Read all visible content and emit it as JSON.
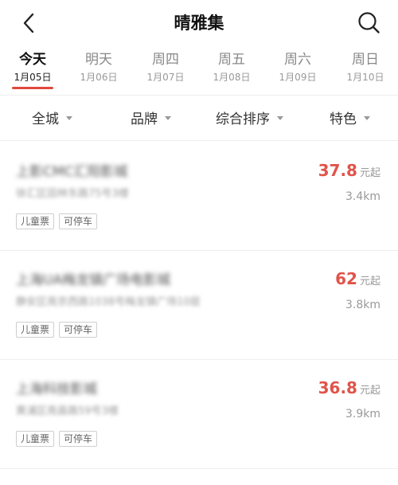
{
  "header": {
    "title": "晴雅集",
    "back_icon": "chevron-left-icon",
    "search_icon": "search-icon"
  },
  "dates": [
    {
      "weekday": "今天",
      "date": "1月05日",
      "active": true
    },
    {
      "weekday": "明天",
      "date": "1月06日",
      "active": false
    },
    {
      "weekday": "周四",
      "date": "1月07日",
      "active": false
    },
    {
      "weekday": "周五",
      "date": "1月08日",
      "active": false
    },
    {
      "weekday": "周六",
      "date": "1月09日",
      "active": false
    },
    {
      "weekday": "周日",
      "date": "1月10日",
      "active": false
    }
  ],
  "filters": [
    {
      "label": "全城"
    },
    {
      "label": "品牌"
    },
    {
      "label": "综合排序"
    },
    {
      "label": "特色"
    }
  ],
  "cinemas": [
    {
      "name": "上影CMC汇阳影城",
      "address": "徐汇区田林东路75号3楼",
      "price": "37.8",
      "price_unit": "元起",
      "distance": "3.4km",
      "tags": [
        "儿童票",
        "可停车"
      ]
    },
    {
      "name": "上海UA梅龙镇广场电影城",
      "address": "静安区南京西路1038号梅龙镇广场10层",
      "price": "62",
      "price_unit": "元起",
      "distance": "3.8km",
      "tags": [
        "儿童票",
        "可停车"
      ]
    },
    {
      "name": "上海科技影城",
      "address": "黄浦区南昌路59号3楼",
      "price": "36.8",
      "price_unit": "元起",
      "distance": "3.9km",
      "tags": [
        "儿童票",
        "可停车"
      ]
    }
  ],
  "colors": {
    "accent": "#e2483e",
    "price": "#e0544a"
  }
}
